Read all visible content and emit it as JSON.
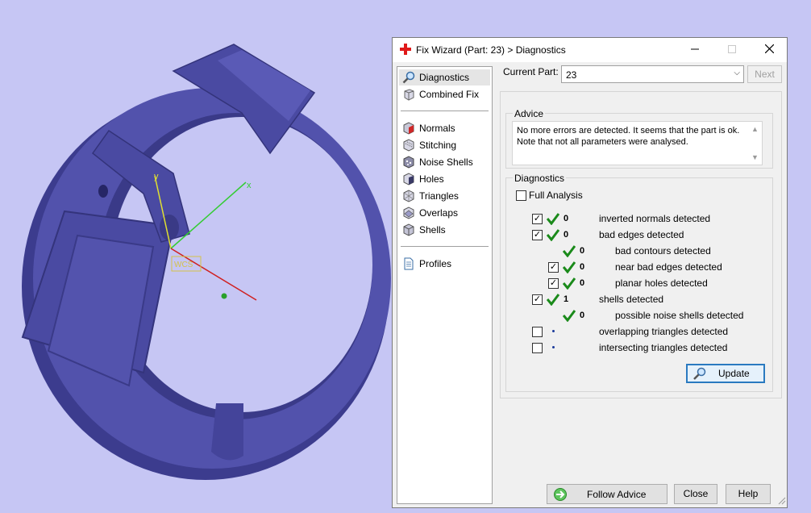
{
  "window": {
    "title": "Fix Wizard (Part: 23) > Diagnostics"
  },
  "scene": {
    "axis_labels": {
      "x": "x",
      "y": "y"
    },
    "wcs_label": "WCS",
    "colors": {
      "background": "#c6c6f4",
      "model": "#4f4fa8",
      "x_axis": "#33cc33",
      "y_axis": "#e0e030",
      "z_axis": "#d02020"
    }
  },
  "sidebar": {
    "items": [
      {
        "label": "Diagnostics",
        "icon": "magnifier-icon",
        "selected": true
      },
      {
        "label": "Combined Fix",
        "icon": "cube-icon"
      },
      {
        "label": "Normals",
        "icon": "normals-cube-icon"
      },
      {
        "label": "Stitching",
        "icon": "stitching-cube-icon"
      },
      {
        "label": "Noise Shells",
        "icon": "noise-cube-icon"
      },
      {
        "label": "Holes",
        "icon": "holes-cube-icon"
      },
      {
        "label": "Triangles",
        "icon": "triangles-cube-icon"
      },
      {
        "label": "Overlaps",
        "icon": "overlaps-cube-icon"
      },
      {
        "label": "Shells",
        "icon": "shells-cube-icon"
      },
      {
        "label": "Profiles",
        "icon": "document-icon"
      }
    ]
  },
  "part": {
    "label": "Current Part:",
    "value": "23",
    "next_label": "Next"
  },
  "advice": {
    "title": "Advice",
    "text": "No more errors are detected. It seems that the part is ok.\nNote that not all parameters were analysed."
  },
  "diagnostics": {
    "title": "Diagnostics",
    "full_analysis_label": "Full Analysis",
    "full_analysis_checked": false,
    "rows": [
      {
        "checked": true,
        "status": "ok",
        "count": "0",
        "label": "inverted normals detected"
      },
      {
        "checked": true,
        "status": "ok",
        "count": "0",
        "label": "bad edges detected"
      },
      {
        "checked": null,
        "status": "ok",
        "count": "0",
        "label": "bad contours detected"
      },
      {
        "checked": true,
        "status": "ok",
        "count": "0",
        "label": "near bad edges detected"
      },
      {
        "checked": true,
        "status": "ok",
        "count": "0",
        "label": "planar holes detected"
      },
      {
        "checked": true,
        "status": "ok",
        "count": "1",
        "label": "shells detected"
      },
      {
        "checked": null,
        "status": "ok",
        "count": "0",
        "label": "possible noise shells detected"
      },
      {
        "checked": false,
        "status": "pending",
        "count": "",
        "label": "overlapping triangles detected"
      },
      {
        "checked": false,
        "status": "pending",
        "count": "",
        "label": "intersecting triangles detected"
      }
    ],
    "update_label": "Update"
  },
  "footer": {
    "follow_label": "Follow Advice",
    "close_label": "Close",
    "help_label": "Help"
  }
}
